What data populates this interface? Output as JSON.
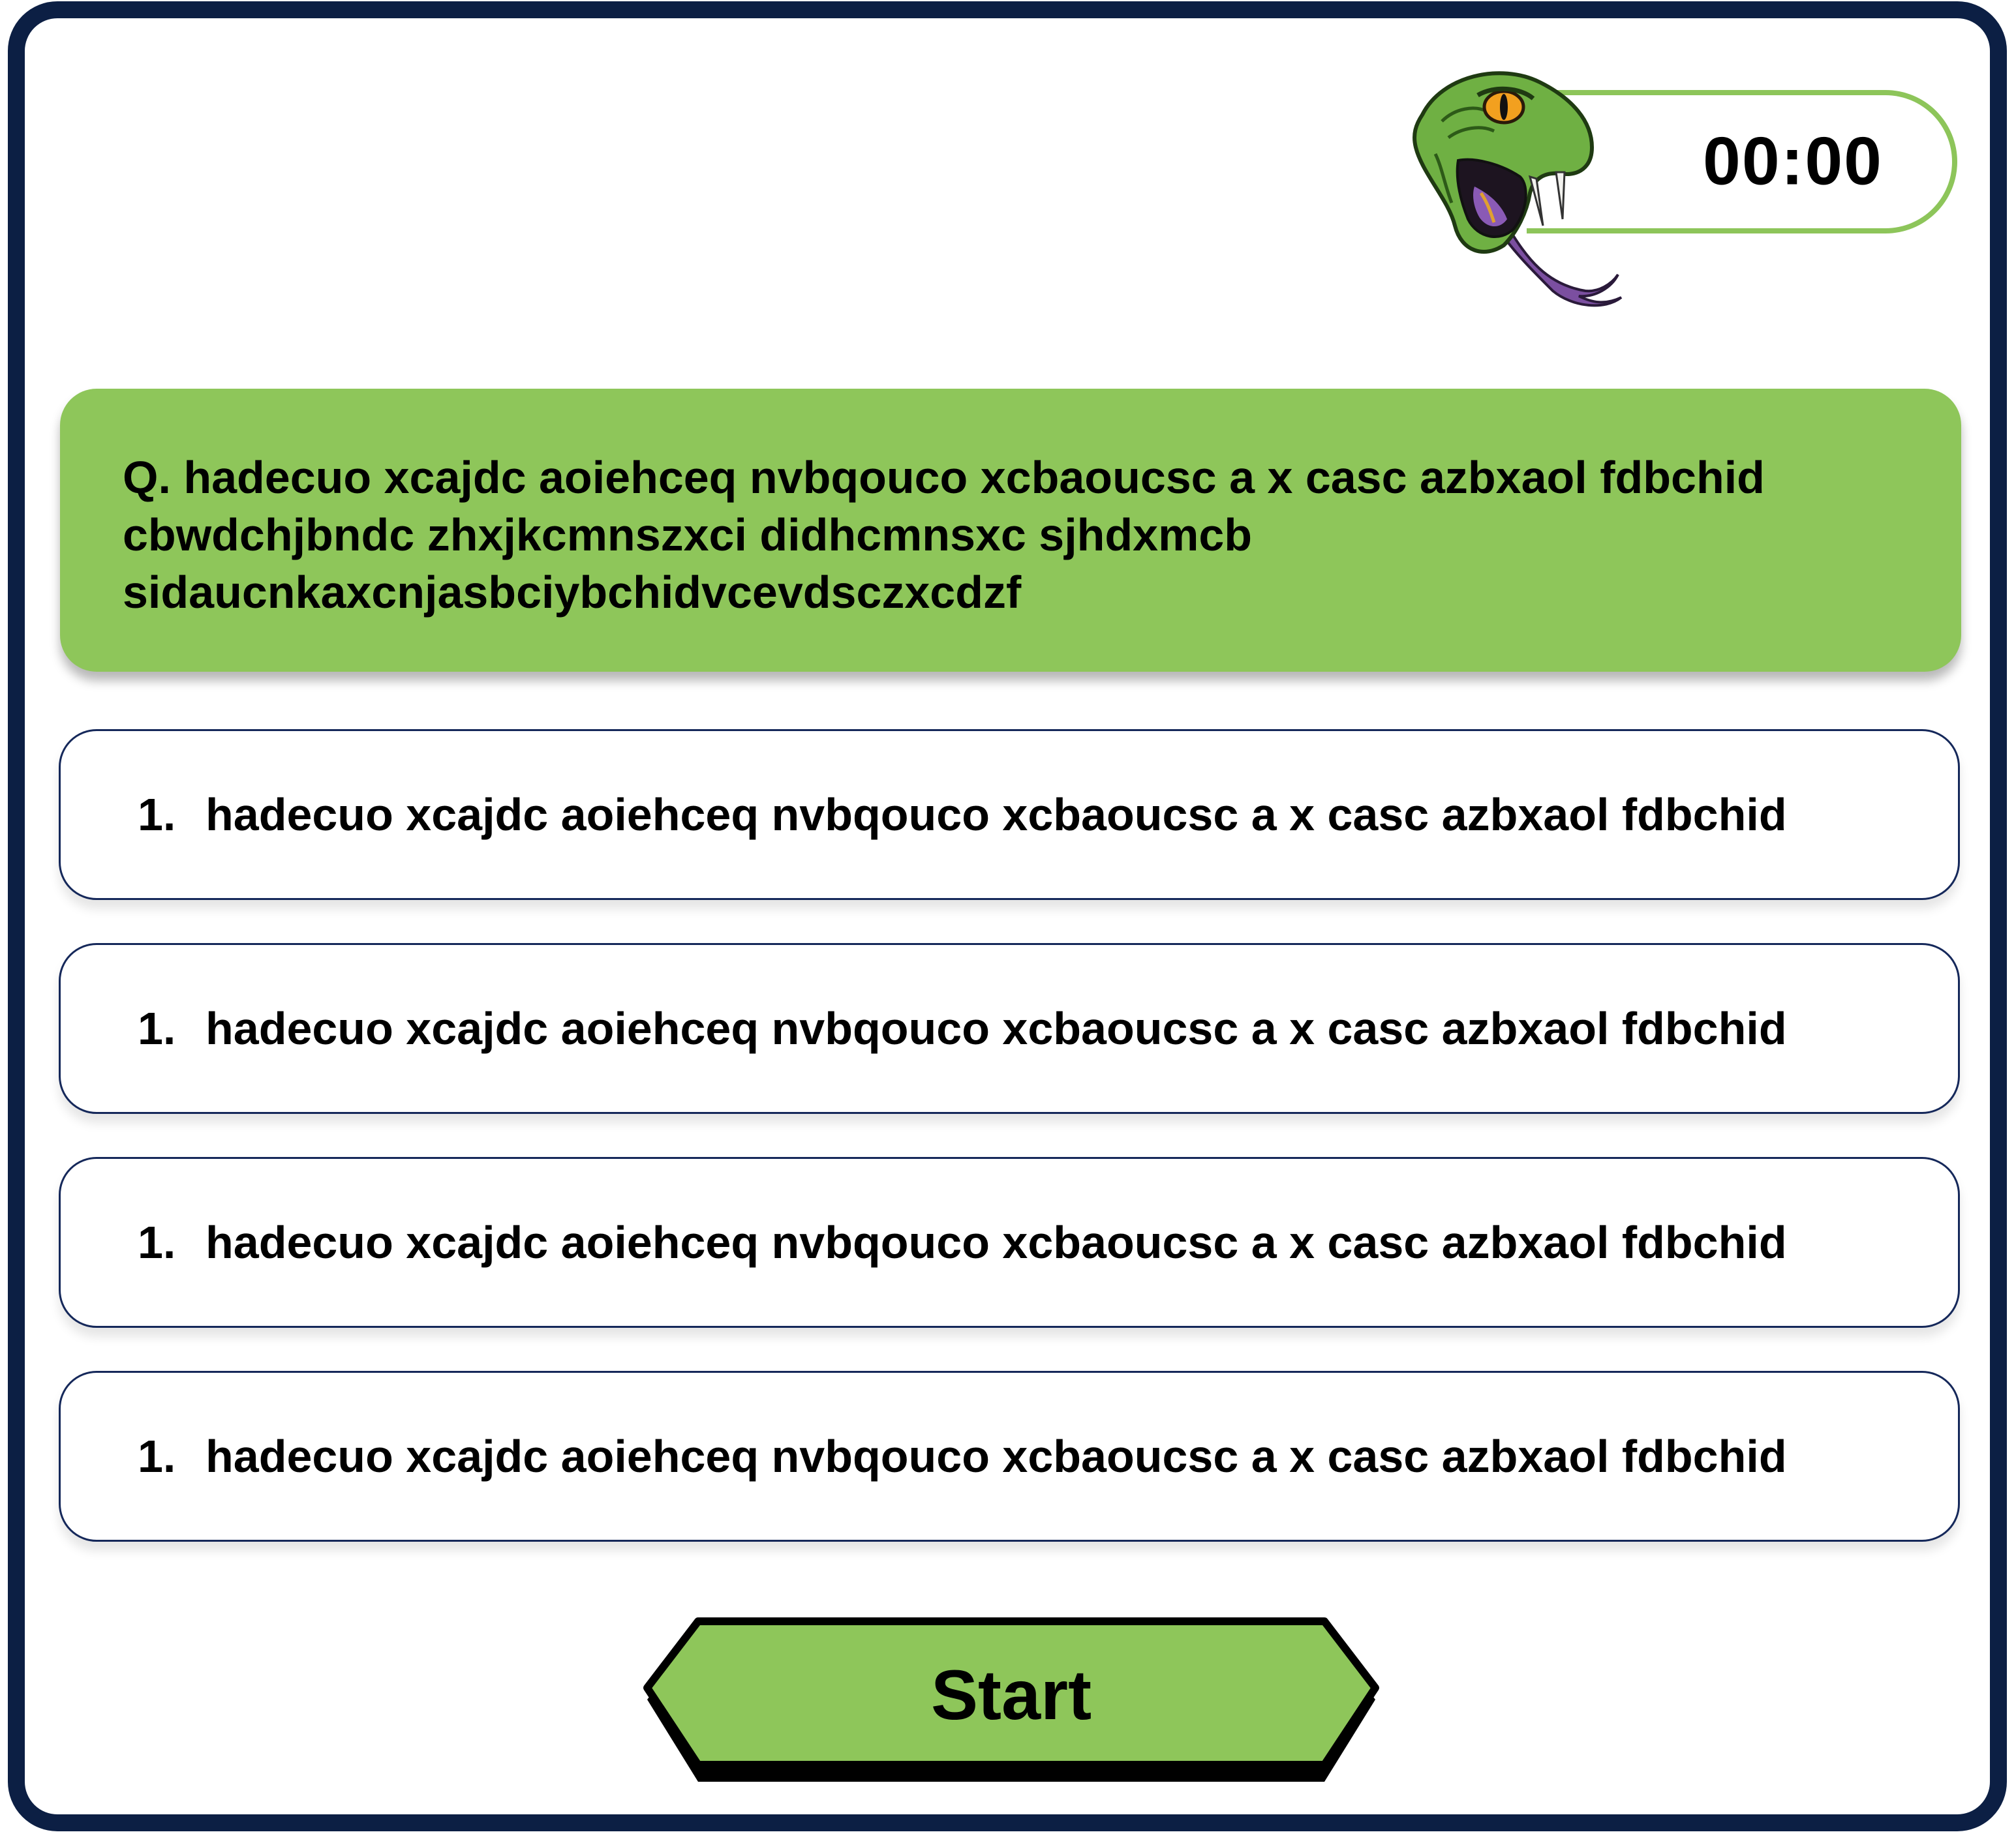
{
  "timer": {
    "value": "00:00",
    "accent_color": "#8dc55a"
  },
  "mascot": {
    "icon": "snake-head-icon"
  },
  "question": {
    "text": "Q. hadecuo xcajdc aoiehceq nvbqouco xcbaoucsc a x casc azbxaol fdbchid cbwdchjbndc zhxjkcmnszxci didhcmnsxc sjhdxmcb sidaucnkaxcnjasbciybchidvcevdsczxcdzf",
    "background": "#8ec65a"
  },
  "options": [
    {
      "number": "1.",
      "text": "hadecuo xcajdc aoiehceq nvbqouco xcbaoucsc a x casc azbxaol fdbchid"
    },
    {
      "number": "1.",
      "text": "hadecuo xcajdc aoiehceq nvbqouco xcbaoucsc a x casc azbxaol fdbchid"
    },
    {
      "number": "1.",
      "text": "hadecuo xcajdc aoiehceq nvbqouco xcbaoucsc a x casc azbxaol fdbchid"
    },
    {
      "number": "1.",
      "text": "hadecuo xcajdc aoiehceq nvbqouco xcbaoucsc a x casc azbxaol fdbchid"
    }
  ],
  "start_button": {
    "label": "Start",
    "fill": "#8ec65a",
    "outline": "#000000"
  },
  "frame": {
    "border_color": "#0c1f44"
  }
}
